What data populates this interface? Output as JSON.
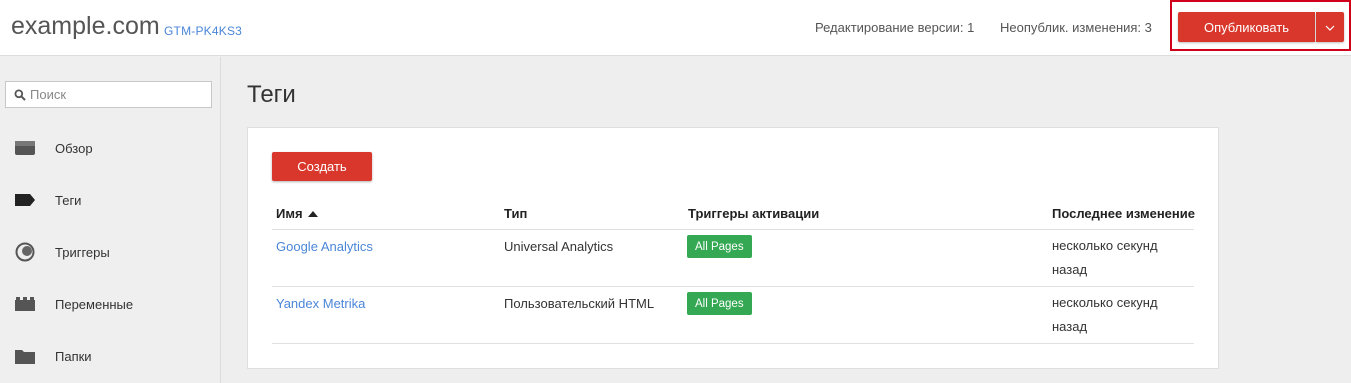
{
  "header": {
    "site_name": "example.com",
    "container_id": "GTM-PK4KS3",
    "version_editing": "Редактирование версии: 1",
    "unpublished_changes": "Неопублик. изменения: 3",
    "publish_label": "Опубликовать",
    "highlight_color": "#d0021b"
  },
  "sidebar": {
    "search_placeholder": "Поиск",
    "items": [
      {
        "label": "Обзор",
        "icon": "overview-icon"
      },
      {
        "label": "Теги",
        "icon": "tag-icon"
      },
      {
        "label": "Триггеры",
        "icon": "trigger-icon"
      },
      {
        "label": "Переменные",
        "icon": "variables-icon"
      },
      {
        "label": "Папки",
        "icon": "folder-icon"
      }
    ]
  },
  "main": {
    "title": "Теги",
    "create_label": "Создать",
    "columns": [
      "Имя",
      "Тип",
      "Триггеры активации",
      "Последнее изменение"
    ],
    "rows": [
      {
        "name": "Google Analytics",
        "type": "Universal Analytics",
        "trigger": "All Pages",
        "last_changed_1": "несколько секунд",
        "last_changed_2": "назад"
      },
      {
        "name": "Yandex Metrika",
        "type": "Пользовательский HTML",
        "trigger": "All Pages",
        "last_changed_1": "несколько секунд",
        "last_changed_2": "назад"
      }
    ]
  },
  "colors": {
    "accent": "#d9372c",
    "link": "#4a86d8",
    "badge": "#34a853"
  }
}
